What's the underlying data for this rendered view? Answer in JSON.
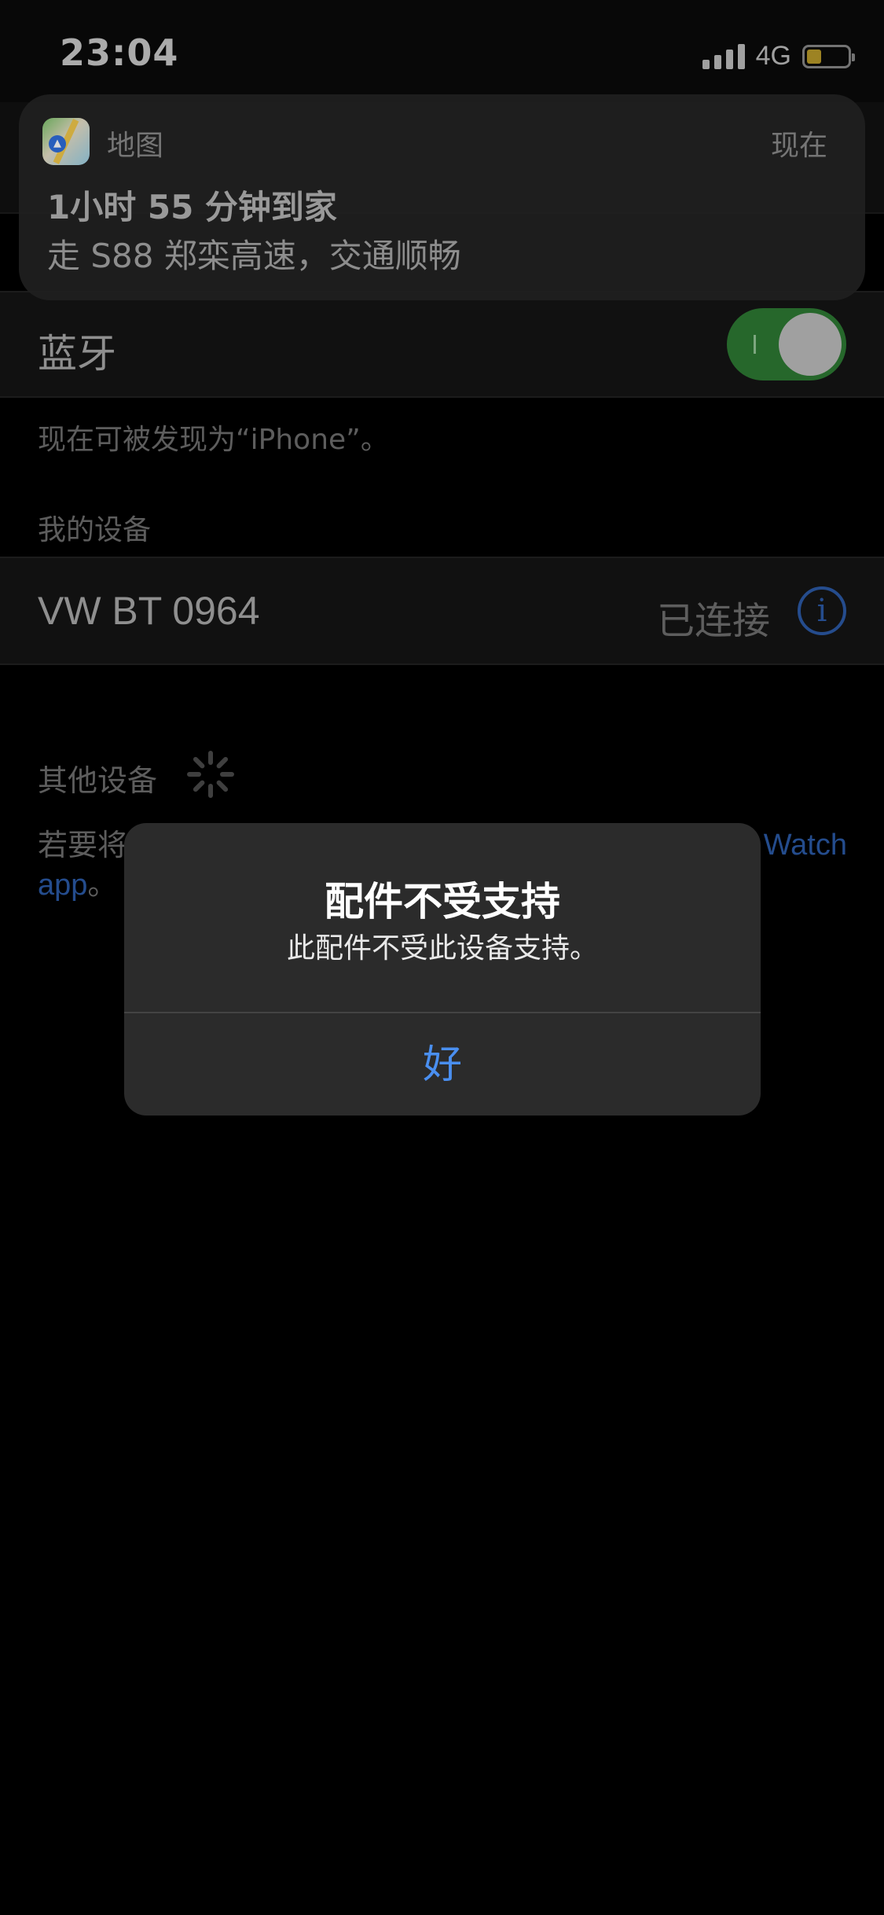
{
  "status_bar": {
    "time": "23:04",
    "network": "4G",
    "battery_level": 0.35,
    "battery_color": "#b99a2a"
  },
  "notification": {
    "app_name": "地图",
    "time": "现在",
    "title": "1小时 55 分钟到家",
    "body": "走 S88 郑栾高速，交通顺畅",
    "icon": "maps-app-icon"
  },
  "bluetooth": {
    "label": "蓝牙",
    "enabled": true,
    "toggle_color": "#2d7a33",
    "discoverable_text": "现在可被发现为“iPhone”。"
  },
  "my_devices": {
    "header": "我的设备",
    "items": [
      {
        "name": "VW BT 0964",
        "status": "已连接"
      }
    ]
  },
  "other_devices": {
    "header": "其他设备",
    "pairing_text_start": "若要将",
    "pairing_link_right": "Watch",
    "pairing_link_end": "app",
    "pairing_text_end": "。"
  },
  "alert": {
    "title": "配件不受支持",
    "message": "此配件不受此设备支持。",
    "button": "好",
    "button_color": "#4a8ff0"
  }
}
